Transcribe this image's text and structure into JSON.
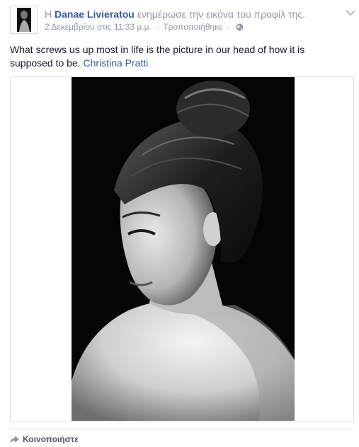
{
  "post": {
    "article_prefix": "Η",
    "author_name": "Danae Livieratou",
    "action_text": "ενημέρωσε την εικόνα του προφίλ της.",
    "timestamp": "2 Δεκεμβρίου στις 11:33 μ.μ.",
    "separator": "·",
    "edited_label": "Τροποποιήθηκε",
    "audience_icon": "globe-icon",
    "text": "What screws us up most in life is the picture in our head of how it is supposed to be.",
    "tagged_name": "Christina Pratti",
    "photo_description": "black-and-white portrait photo"
  },
  "actions": {
    "share_label": "Κοινοποιήστε",
    "share_icon": "share-arrow-icon",
    "menu_icon": "chevron-down-icon"
  },
  "colors": {
    "link": "#3b5998",
    "muted": "#9197a3",
    "text": "#141823",
    "photo_background": "#050505"
  }
}
